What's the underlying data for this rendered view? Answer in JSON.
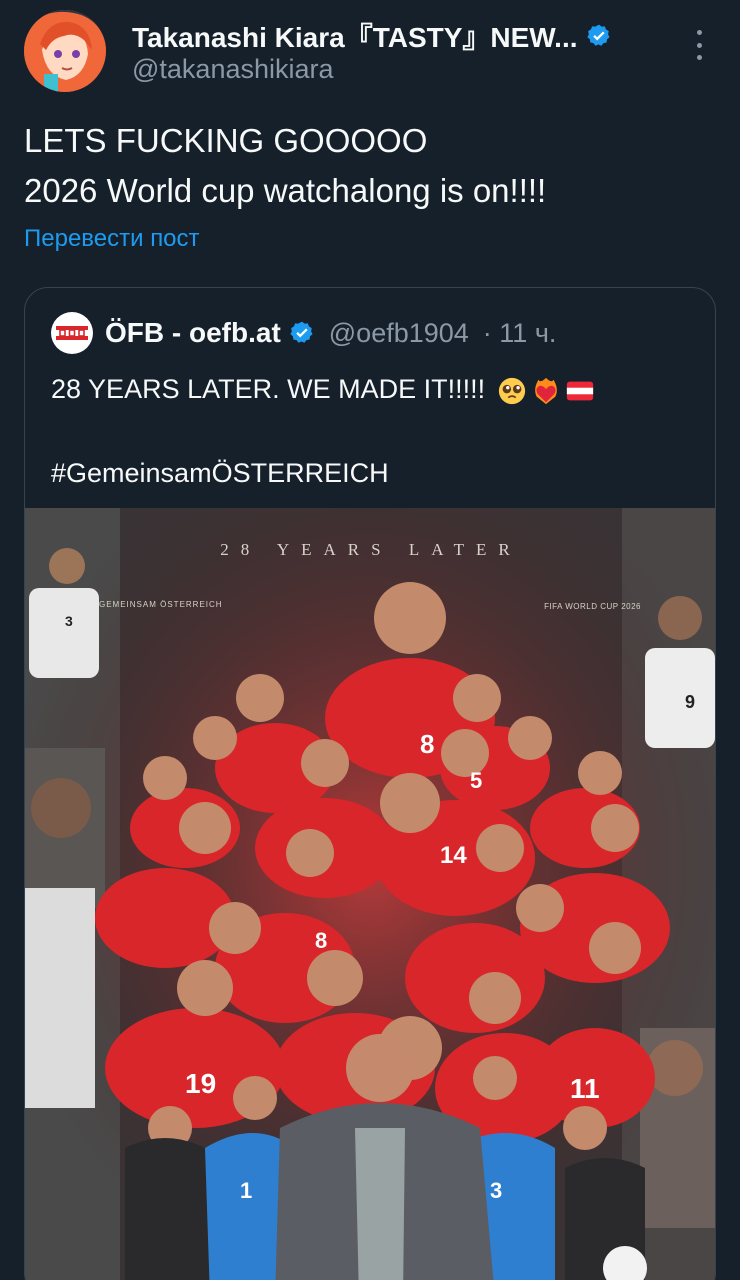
{
  "author": {
    "display_name": "Takanashi Kiara『TASTY』NEW...",
    "handle": "@takanashikiara",
    "verified": true
  },
  "tweet": {
    "lines": [
      "LETS FUCKING GOOOOO",
      "2026 World cup watchalong is on!!!!"
    ],
    "translate_link": "Перевести пост"
  },
  "quoted": {
    "display_name": "ÖFB - oefb.at",
    "handle": "@oefb1904",
    "timestamp": "· 11 ч.",
    "line1": "28 YEARS LATER. WE MADE IT!!!!!",
    "line2": "#GemeinsamÖSTERREICH",
    "emojis": [
      "pleading-face",
      "heart-on-fire",
      "austria-flag"
    ],
    "media": {
      "poster_title": "28 YEARS LATER",
      "poster_left": "GEMEINSAM ÖSTERREICH",
      "poster_right": "FIFA WORLD CUP 2026"
    }
  },
  "colors": {
    "background": "#15202b",
    "text": "#f7f9f9",
    "muted": "#8b98a5",
    "link": "#1d9bf0",
    "border": "#38444d",
    "kit_red": "#d9262b"
  },
  "icons": [
    "verified-badge-icon",
    "more-options-icon"
  ]
}
